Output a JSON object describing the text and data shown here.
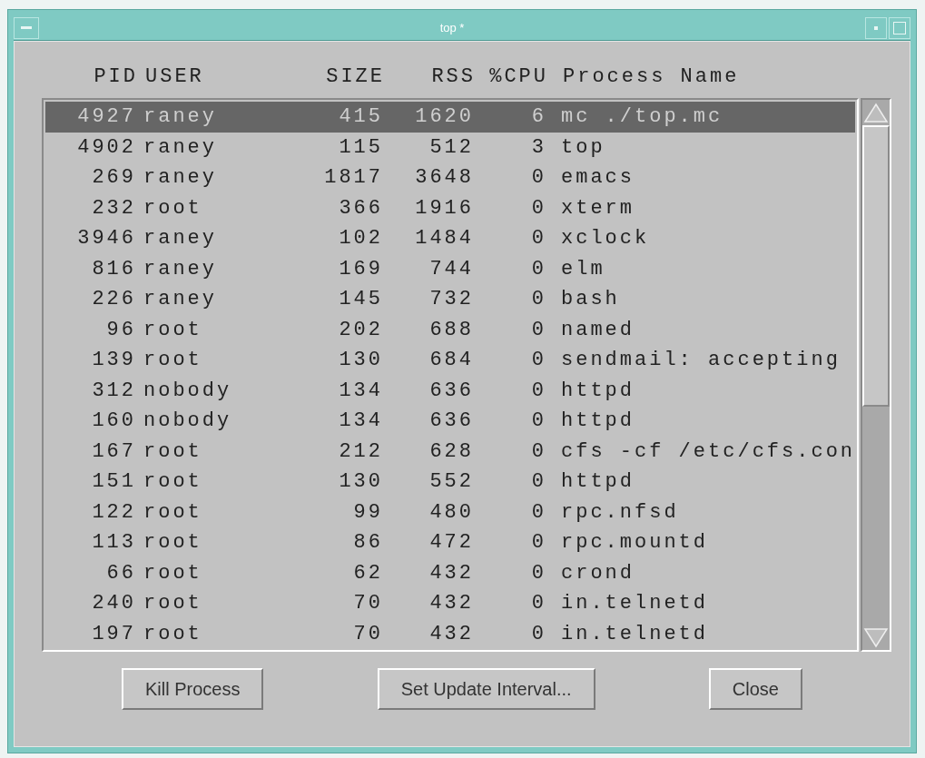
{
  "window": {
    "title": "top *"
  },
  "columns": [
    "PID",
    "USER",
    "SIZE",
    "RSS",
    "%CPU",
    "Process Name"
  ],
  "rows": [
    {
      "pid": "4927",
      "user": "raney",
      "size": "415",
      "rss": "1620",
      "cpu": "6",
      "name": "mc ./top.mc",
      "selected": true
    },
    {
      "pid": "4902",
      "user": "raney",
      "size": "115",
      "rss": "512",
      "cpu": "3",
      "name": "top",
      "selected": false
    },
    {
      "pid": "269",
      "user": "raney",
      "size": "1817",
      "rss": "3648",
      "cpu": "0",
      "name": "emacs",
      "selected": false
    },
    {
      "pid": "232",
      "user": "root",
      "size": "366",
      "rss": "1916",
      "cpu": "0",
      "name": "xterm",
      "selected": false
    },
    {
      "pid": "3946",
      "user": "raney",
      "size": "102",
      "rss": "1484",
      "cpu": "0",
      "name": "xclock",
      "selected": false
    },
    {
      "pid": "816",
      "user": "raney",
      "size": "169",
      "rss": "744",
      "cpu": "0",
      "name": "elm",
      "selected": false
    },
    {
      "pid": "226",
      "user": "raney",
      "size": "145",
      "rss": "732",
      "cpu": "0",
      "name": "bash",
      "selected": false
    },
    {
      "pid": "96",
      "user": "root",
      "size": "202",
      "rss": "688",
      "cpu": "0",
      "name": "named",
      "selected": false
    },
    {
      "pid": "139",
      "user": "root",
      "size": "130",
      "rss": "684",
      "cpu": "0",
      "name": "sendmail: accepting",
      "selected": false
    },
    {
      "pid": "312",
      "user": "nobody",
      "size": "134",
      "rss": "636",
      "cpu": "0",
      "name": "httpd",
      "selected": false
    },
    {
      "pid": "160",
      "user": "nobody",
      "size": "134",
      "rss": "636",
      "cpu": "0",
      "name": "httpd",
      "selected": false
    },
    {
      "pid": "167",
      "user": "root",
      "size": "212",
      "rss": "628",
      "cpu": "0",
      "name": "cfs -cf /etc/cfs.con",
      "selected": false
    },
    {
      "pid": "151",
      "user": "root",
      "size": "130",
      "rss": "552",
      "cpu": "0",
      "name": "httpd",
      "selected": false
    },
    {
      "pid": "122",
      "user": "root",
      "size": "99",
      "rss": "480",
      "cpu": "0",
      "name": "rpc.nfsd",
      "selected": false
    },
    {
      "pid": "113",
      "user": "root",
      "size": "86",
      "rss": "472",
      "cpu": "0",
      "name": "rpc.mountd",
      "selected": false
    },
    {
      "pid": "66",
      "user": "root",
      "size": "62",
      "rss": "432",
      "cpu": "0",
      "name": "crond",
      "selected": false
    },
    {
      "pid": "240",
      "user": "root",
      "size": "70",
      "rss": "432",
      "cpu": "0",
      "name": "in.telnetd",
      "selected": false
    },
    {
      "pid": "197",
      "user": "root",
      "size": "70",
      "rss": "432",
      "cpu": "0",
      "name": "in.telnetd",
      "selected": false
    }
  ],
  "buttons": [
    "Kill Process",
    "Set Update Interval...",
    "Close"
  ]
}
